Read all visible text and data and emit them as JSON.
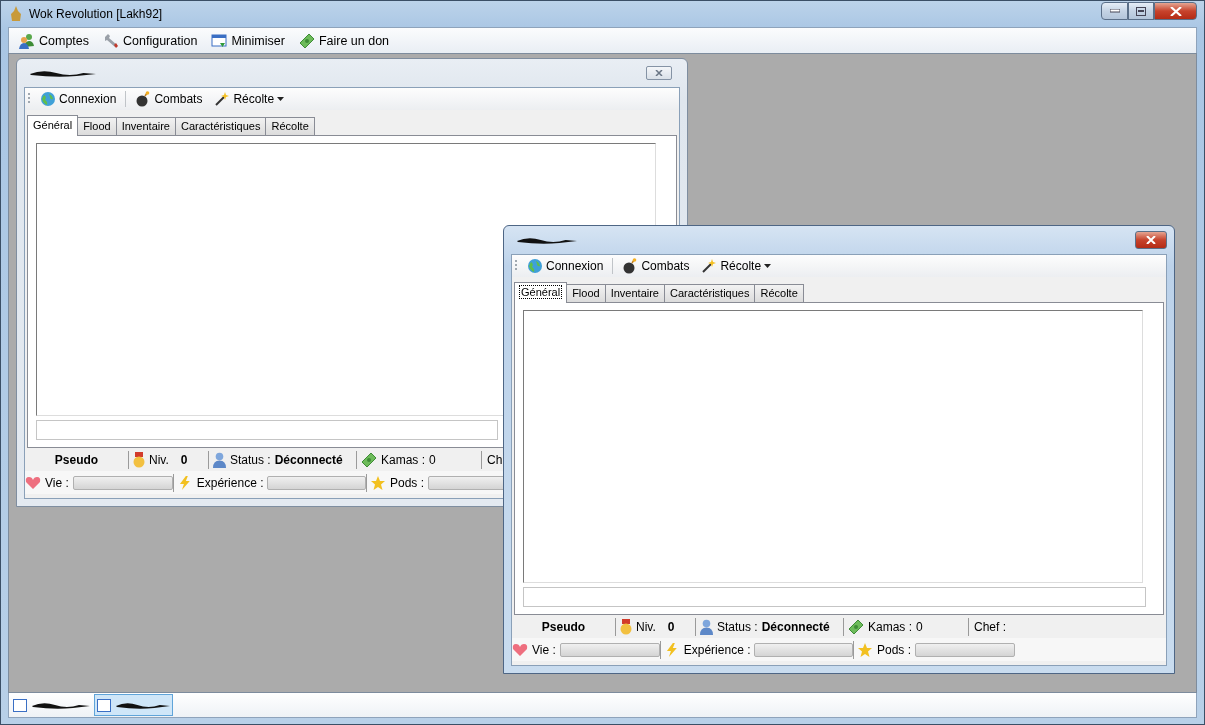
{
  "window": {
    "title": "Wok Revolution [Lakh92]"
  },
  "menu": [
    {
      "label": "Comptes"
    },
    {
      "label": "Configuration"
    },
    {
      "label": "Minimiser"
    },
    {
      "label": "Faire un don"
    }
  ],
  "children": [
    {
      "active": false,
      "toolbar": [
        {
          "label": "Connexion",
          "dropdown": false
        },
        {
          "label": "Combats",
          "dropdown": false
        },
        {
          "label": "Récolte",
          "dropdown": true
        }
      ],
      "tabs": [
        {
          "label": "Général",
          "selected": true
        },
        {
          "label": "Flood",
          "selected": false
        },
        {
          "label": "Inventaire",
          "selected": false
        },
        {
          "label": "Caractéristiques",
          "selected": false
        },
        {
          "label": "Récolte",
          "selected": false
        }
      ],
      "status": {
        "pseudo": "Pseudo",
        "niv_label": "Niv.",
        "niv_value": "0",
        "status_label": "Status :",
        "status_value": "Déconnecté",
        "kamas_label": "Kamas :",
        "kamas_value": "0",
        "chef_label": "Ch"
      },
      "gauges": [
        {
          "label": "Vie :",
          "level": 0
        },
        {
          "label": "Expérience :",
          "level": 0
        },
        {
          "label": "Pods :",
          "level": 0
        }
      ]
    },
    {
      "active": true,
      "toolbar": [
        {
          "label": "Connexion",
          "dropdown": false
        },
        {
          "label": "Combats",
          "dropdown": false
        },
        {
          "label": "Récolte",
          "dropdown": true
        }
      ],
      "tabs": [
        {
          "label": "Général",
          "selected": true
        },
        {
          "label": "Flood",
          "selected": false
        },
        {
          "label": "Inventaire",
          "selected": false
        },
        {
          "label": "Caractéristiques",
          "selected": false
        },
        {
          "label": "Récolte",
          "selected": false
        }
      ],
      "status": {
        "pseudo": "Pseudo",
        "niv_label": "Niv.",
        "niv_value": "0",
        "status_label": "Status :",
        "status_value": "Déconnecté",
        "kamas_label": "Kamas :",
        "kamas_value": "0",
        "chef_label": "Chef :"
      },
      "gauges": [
        {
          "label": "Vie :",
          "level": 0
        },
        {
          "label": "Expérience :",
          "level": 0
        },
        {
          "label": "Pods :",
          "level": 0
        }
      ]
    }
  ],
  "taskbar": [
    {
      "selected": false
    },
    {
      "selected": true
    }
  ]
}
